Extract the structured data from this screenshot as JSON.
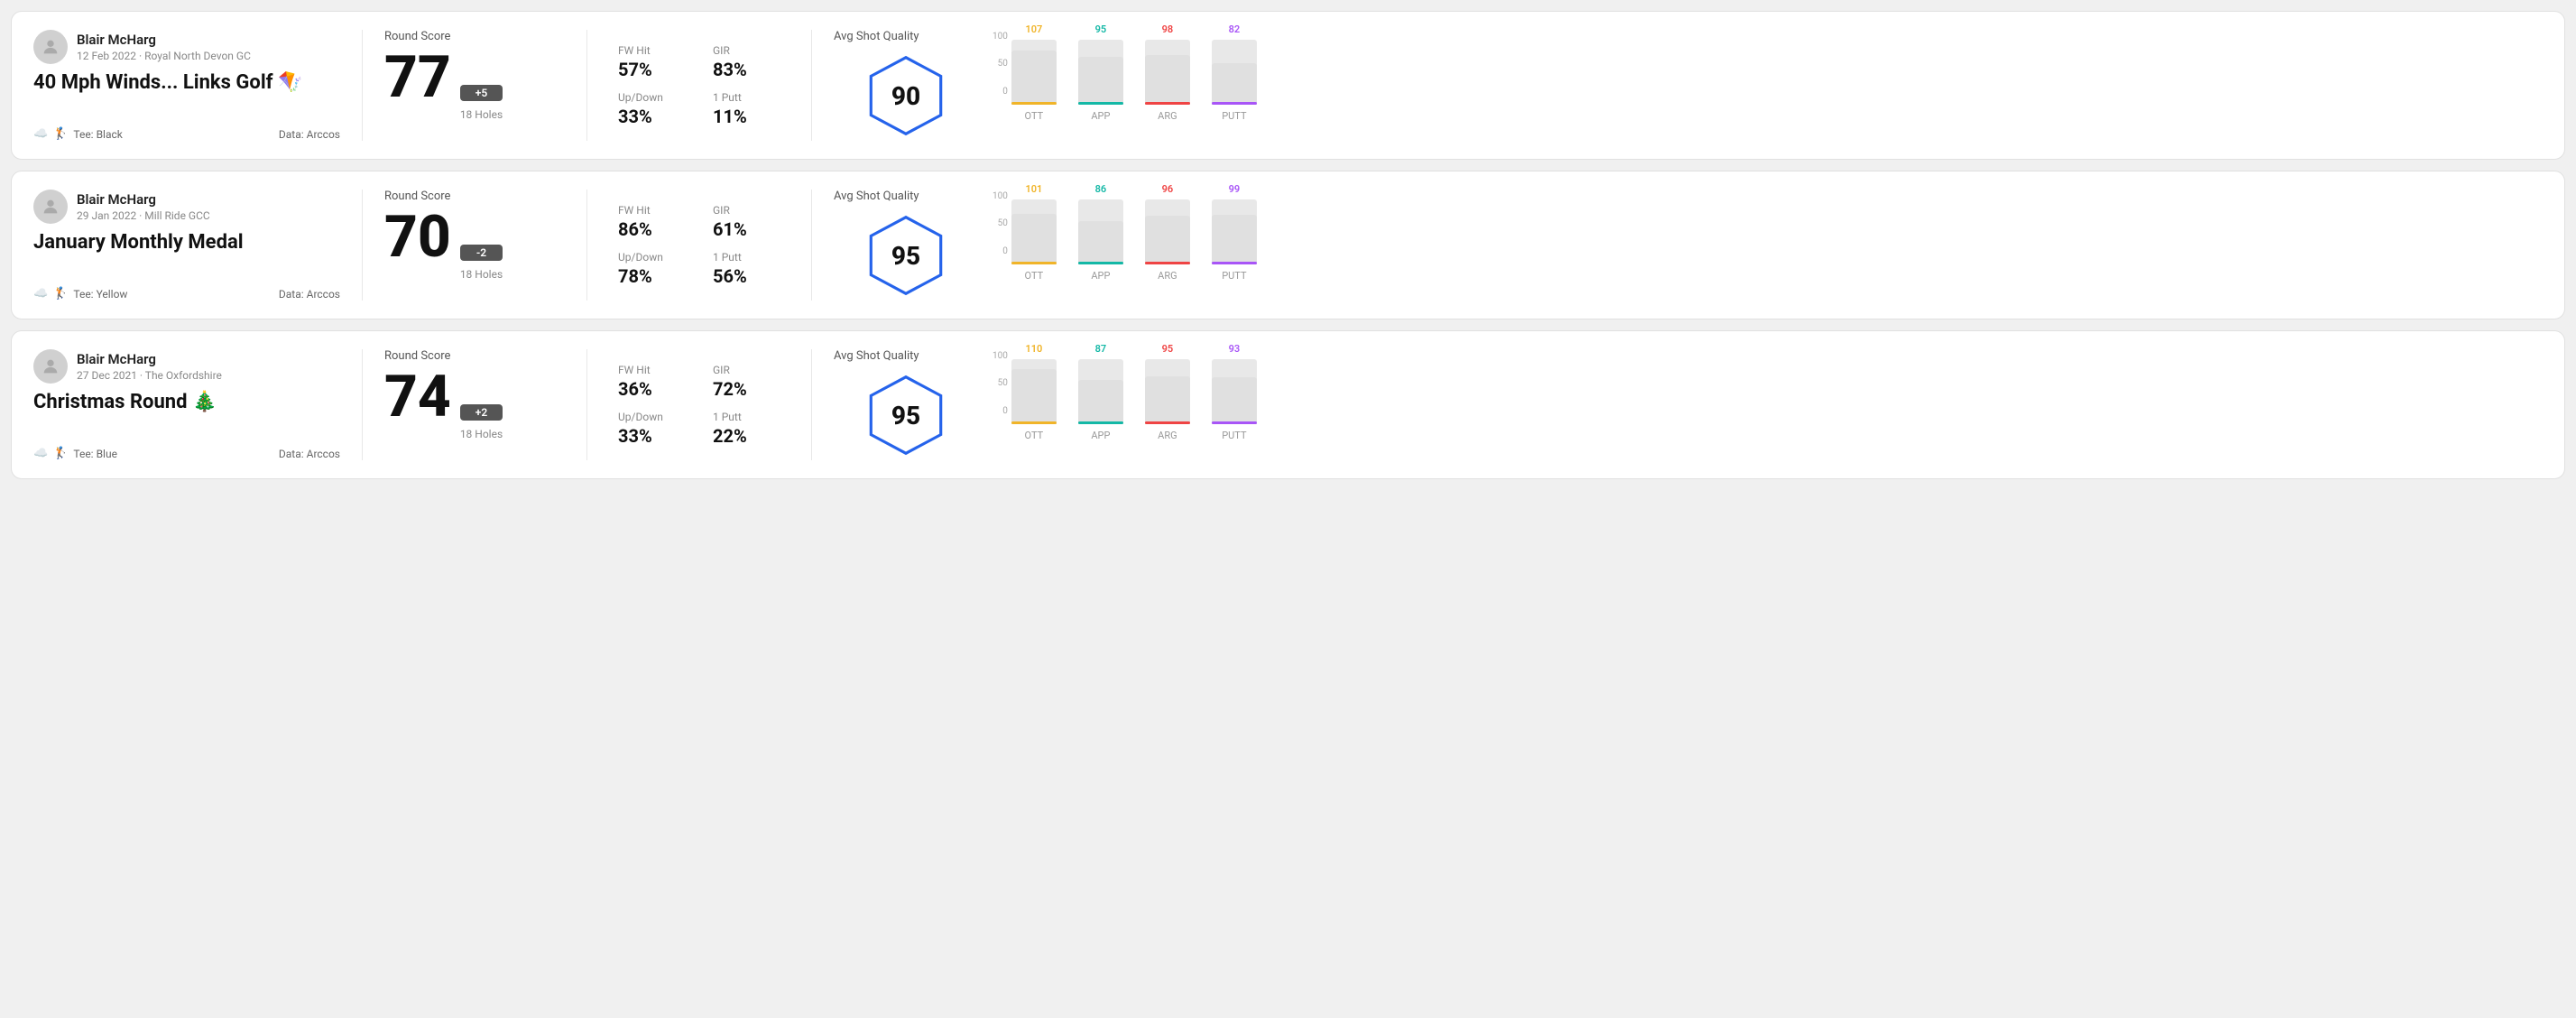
{
  "rounds": [
    {
      "id": "round1",
      "userName": "Blair McHarg",
      "userMeta": "12 Feb 2022 · Royal North Devon GC",
      "title": "40 Mph Winds... Links Golf 🪁",
      "tee": "Tee: Black",
      "dataSource": "Data: Arccos",
      "score": "77",
      "scoreDiff": "+5",
      "holes": "18 Holes",
      "fwHit": "57%",
      "gir": "83%",
      "upDown": "33%",
      "onePutt": "11%",
      "avgQuality": "90",
      "bars": [
        {
          "label": "OTT",
          "value": 107,
          "color": "#f0b429",
          "maxVal": 130
        },
        {
          "label": "APP",
          "value": 95,
          "color": "#14b8a6",
          "maxVal": 130
        },
        {
          "label": "ARG",
          "value": 98,
          "color": "#ef4444",
          "maxVal": 130
        },
        {
          "label": "PUTT",
          "value": 82,
          "color": "#a855f7",
          "maxVal": 130
        }
      ]
    },
    {
      "id": "round2",
      "userName": "Blair McHarg",
      "userMeta": "29 Jan 2022 · Mill Ride GCC",
      "title": "January Monthly Medal",
      "tee": "Tee: Yellow",
      "dataSource": "Data: Arccos",
      "score": "70",
      "scoreDiff": "-2",
      "holes": "18 Holes",
      "fwHit": "86%",
      "gir": "61%",
      "upDown": "78%",
      "onePutt": "56%",
      "avgQuality": "95",
      "bars": [
        {
          "label": "OTT",
          "value": 101,
          "color": "#f0b429",
          "maxVal": 130
        },
        {
          "label": "APP",
          "value": 86,
          "color": "#14b8a6",
          "maxVal": 130
        },
        {
          "label": "ARG",
          "value": 96,
          "color": "#ef4444",
          "maxVal": 130
        },
        {
          "label": "PUTT",
          "value": 99,
          "color": "#a855f7",
          "maxVal": 130
        }
      ]
    },
    {
      "id": "round3",
      "userName": "Blair McHarg",
      "userMeta": "27 Dec 2021 · The Oxfordshire",
      "title": "Christmas Round 🎄",
      "tee": "Tee: Blue",
      "dataSource": "Data: Arccos",
      "score": "74",
      "scoreDiff": "+2",
      "holes": "18 Holes",
      "fwHit": "36%",
      "gir": "72%",
      "upDown": "33%",
      "onePutt": "22%",
      "avgQuality": "95",
      "bars": [
        {
          "label": "OTT",
          "value": 110,
          "color": "#f0b429",
          "maxVal": 130
        },
        {
          "label": "APP",
          "value": 87,
          "color": "#14b8a6",
          "maxVal": 130
        },
        {
          "label": "ARG",
          "value": 95,
          "color": "#ef4444",
          "maxVal": 130
        },
        {
          "label": "PUTT",
          "value": 93,
          "color": "#a855f7",
          "maxVal": 130
        }
      ]
    }
  ],
  "labels": {
    "roundScore": "Round Score",
    "avgShotQuality": "Avg Shot Quality",
    "fwHit": "FW Hit",
    "gir": "GIR",
    "upDown": "Up/Down",
    "onePutt": "1 Putt"
  }
}
